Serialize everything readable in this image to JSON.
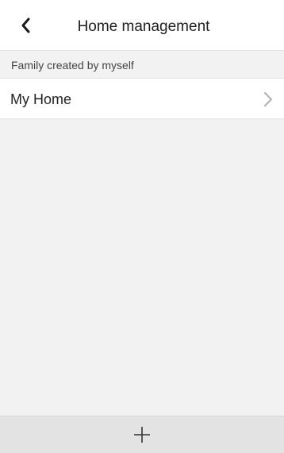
{
  "header": {
    "title": "Home management",
    "back_icon": "chevron-left-icon"
  },
  "section": {
    "label": "Family created by myself"
  },
  "homes": [
    {
      "name": "My Home",
      "icon": "chevron-right-icon"
    }
  ],
  "bottom_bar": {
    "icon": "plus-icon"
  },
  "colors": {
    "background": "#f2f2f2",
    "surface": "#ffffff",
    "bottom_bar": "#e3e3e3",
    "divider": "#e2e2e2",
    "text": "#222222",
    "chevron": "#b5b5b5"
  }
}
